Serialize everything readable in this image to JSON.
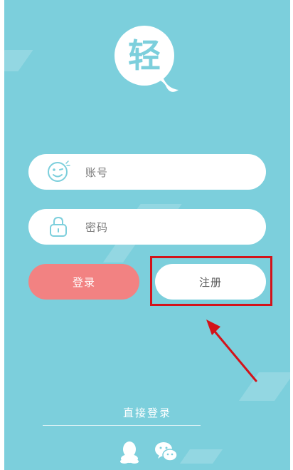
{
  "app": {
    "logo_text": "轻"
  },
  "form": {
    "account_placeholder": "账号",
    "password_placeholder": "密码"
  },
  "buttons": {
    "login_label": "登录",
    "register_label": "注册"
  },
  "footer": {
    "direct_login_label": "直接登录"
  },
  "icons": {
    "account": "smiley-face-icon",
    "password": "lock-icon",
    "qq": "qq-icon",
    "wechat": "wechat-icon"
  },
  "colors": {
    "background": "#7ccfdc",
    "login_button": "#f28282",
    "annotation": "#d3131a"
  }
}
